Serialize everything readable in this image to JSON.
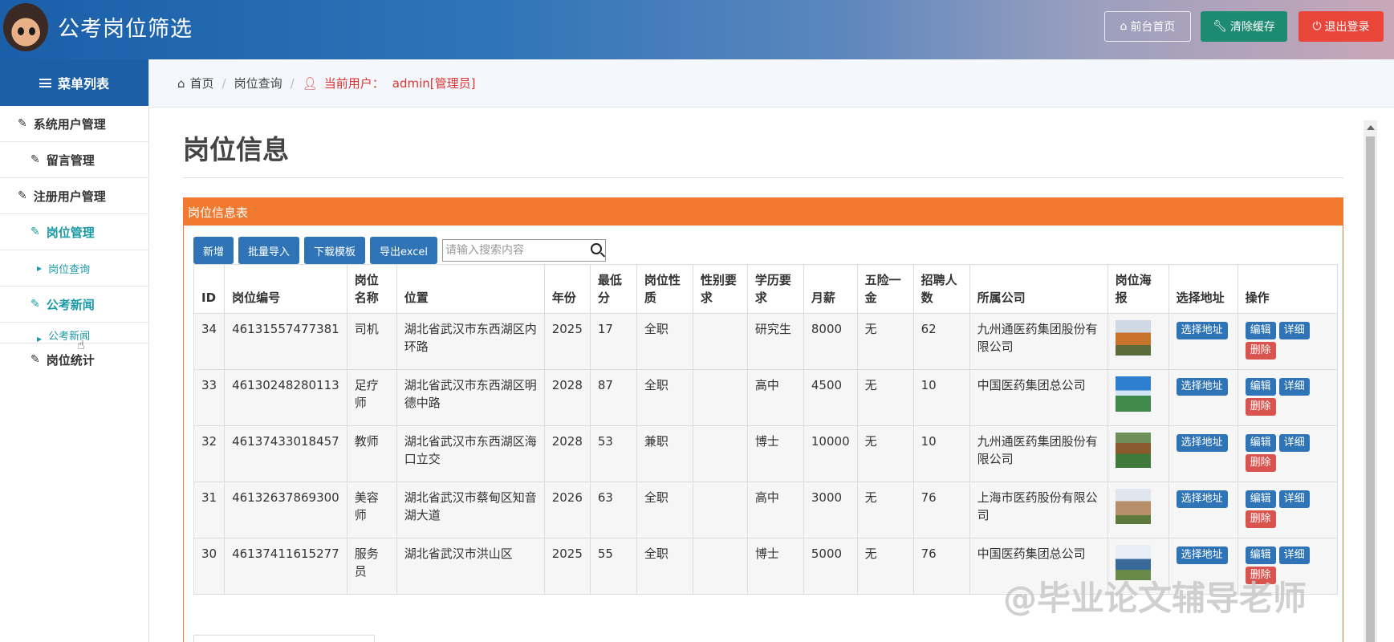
{
  "header": {
    "title": "公考岗位筛选",
    "buttons": {
      "home": "前台首页",
      "cache": "清除缓存",
      "logout": "退出登录"
    }
  },
  "sidebar": {
    "menu_title": "菜单列表",
    "items": [
      {
        "label": "系统用户管理"
      },
      {
        "label": "留言管理"
      },
      {
        "label": "注册用户管理"
      },
      {
        "label": "岗位管理"
      },
      {
        "label": "岗位查询"
      },
      {
        "label": "公考新闻"
      },
      {
        "label": "公考新闻"
      },
      {
        "label": "岗位统计"
      }
    ]
  },
  "breadcrumb": {
    "home": "首页",
    "page": "岗位查询",
    "user_label": "当前用户：",
    "user": "admin[管理员]"
  },
  "main": {
    "title": "岗位信息",
    "panel_title": "岗位信息表",
    "toolbar": {
      "add": "新增",
      "import": "批量导入",
      "template": "下载模板",
      "export": "导出excel"
    },
    "search": {
      "placeholder": "请输入搜索内容"
    },
    "columns": [
      "ID",
      "岗位编号",
      "岗位名称",
      "位置",
      "年份",
      "最低分",
      "岗位性质",
      "性别要求",
      "学历要求",
      "月薪",
      "五险一金",
      "招聘人数",
      "所属公司",
      "岗位海报",
      "选择地址",
      "操作"
    ],
    "actions": {
      "select_addr": "选择地址",
      "edit": "编辑",
      "detail": "详细",
      "delete": "删除"
    },
    "rows": [
      {
        "id": "34",
        "code": "46131557477381",
        "name": "司机",
        "loc": "湖北省武汉市东西湖区内环路",
        "year": "2025",
        "minscore": "17",
        "nature": "全职",
        "gender": "",
        "edu": "研究生",
        "salary": "8000",
        "ins": "无",
        "count": "62",
        "company": "九州通医药集团股份有限公司"
      },
      {
        "id": "33",
        "code": "46130248280113",
        "name": "足疗师",
        "loc": "湖北省武汉市东西湖区明德中路",
        "year": "2028",
        "minscore": "87",
        "nature": "全职",
        "gender": "",
        "edu": "高中",
        "salary": "4500",
        "ins": "无",
        "count": "10",
        "company": "中国医药集团总公司"
      },
      {
        "id": "32",
        "code": "46137433018457",
        "name": "教师",
        "loc": "湖北省武汉市东西湖区海口立交",
        "year": "2028",
        "minscore": "53",
        "nature": "兼职",
        "gender": "",
        "edu": "博士",
        "salary": "10000",
        "ins": "无",
        "count": "10",
        "company": "九州通医药集团股份有限公司"
      },
      {
        "id": "31",
        "code": "46132637869300",
        "name": "美容师",
        "loc": "湖北省武汉市蔡甸区知音湖大道",
        "year": "2026",
        "minscore": "63",
        "nature": "全职",
        "gender": "",
        "edu": "高中",
        "salary": "3000",
        "ins": "无",
        "count": "76",
        "company": "上海市医药股份有限公司"
      },
      {
        "id": "30",
        "code": "46137411615277",
        "name": "服务员",
        "loc": "湖北省武汉市洪山区",
        "year": "2025",
        "minscore": "55",
        "nature": "全职",
        "gender": "",
        "edu": "博士",
        "salary": "5000",
        "ins": "无",
        "count": "76",
        "company": "中国医药集团总公司"
      }
    ]
  },
  "watermark": "@毕业论文辅导老师",
  "colors": {
    "header_start": "#1a5fa8",
    "accent_orange": "#f27a30",
    "primary_blue": "#2f74b7",
    "danger": "#d9534f",
    "teal": "#1a9aa6"
  }
}
